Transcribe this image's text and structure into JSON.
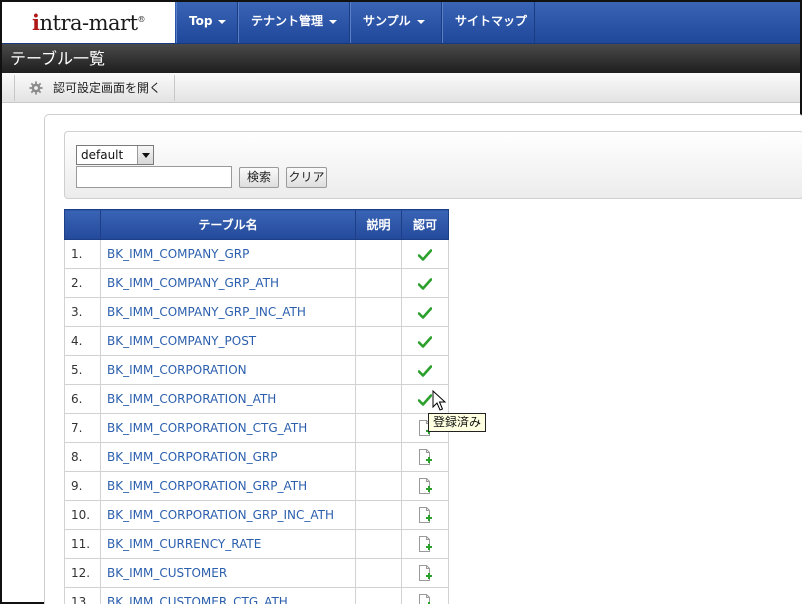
{
  "app": {
    "logo_text": "intra-mart",
    "nav": [
      {
        "label": "Top",
        "dropdown": true
      },
      {
        "label": "テナント管理",
        "dropdown": true
      },
      {
        "label": "サンプル",
        "dropdown": true
      },
      {
        "label": "サイトマップ",
        "dropdown": false
      }
    ]
  },
  "page": {
    "title": "テーブル一覧"
  },
  "toolbar": {
    "open_auth_label": "認可設定画面を開く",
    "icon": "gear-icon"
  },
  "search": {
    "select_value": "default",
    "input_value": "",
    "search_button": "検索",
    "clear_button": "クリア"
  },
  "table": {
    "headers": {
      "name": "テーブル名",
      "description": "説明",
      "permission": "認可"
    },
    "rows": [
      {
        "num": "1.",
        "name": "BK_IMM_COMPANY_GRP",
        "description": "",
        "status": "registered"
      },
      {
        "num": "2.",
        "name": "BK_IMM_COMPANY_GRP_ATH",
        "description": "",
        "status": "registered"
      },
      {
        "num": "3.",
        "name": "BK_IMM_COMPANY_GRP_INC_ATH",
        "description": "",
        "status": "registered"
      },
      {
        "num": "4.",
        "name": "BK_IMM_COMPANY_POST",
        "description": "",
        "status": "registered"
      },
      {
        "num": "5.",
        "name": "BK_IMM_CORPORATION",
        "description": "",
        "status": "registered"
      },
      {
        "num": "6.",
        "name": "BK_IMM_CORPORATION_ATH",
        "description": "",
        "status": "registered"
      },
      {
        "num": "7.",
        "name": "BK_IMM_CORPORATION_CTG_ATH",
        "description": "",
        "status": "new"
      },
      {
        "num": "8.",
        "name": "BK_IMM_CORPORATION_GRP",
        "description": "",
        "status": "new"
      },
      {
        "num": "9.",
        "name": "BK_IMM_CORPORATION_GRP_ATH",
        "description": "",
        "status": "new"
      },
      {
        "num": "10.",
        "name": "BK_IMM_CORPORATION_GRP_INC_ATH",
        "description": "",
        "status": "new"
      },
      {
        "num": "11.",
        "name": "BK_IMM_CURRENCY_RATE",
        "description": "",
        "status": "new"
      },
      {
        "num": "12.",
        "name": "BK_IMM_CUSTOMER",
        "description": "",
        "status": "new"
      },
      {
        "num": "13.",
        "name": "BK_IMM_CUSTOMER_CTG_ATH",
        "description": "",
        "status": "new"
      }
    ]
  },
  "tooltip": {
    "text": "登録済み"
  },
  "colors": {
    "nav_blue": "#2a54a8",
    "title_bar": "#2e2e2e",
    "link": "#2b5fad",
    "check_green": "#2ca02c"
  }
}
